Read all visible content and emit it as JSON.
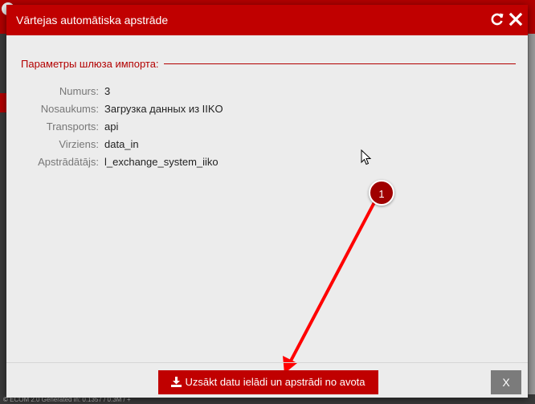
{
  "background": {
    "footer_text": "© ECOM 2.0 Generated in: 0.1357 / 0.3M / +"
  },
  "modal": {
    "title": "Vārtejas automātiska apstrāde",
    "header_icons": [
      "refresh-icon",
      "close-icon"
    ],
    "section_legend": "Параметры шлюза импорта:",
    "fields": [
      {
        "label": "Numurs:",
        "value": "3"
      },
      {
        "label": "Nosaukums:",
        "value": "Загрузка данных из IIKO"
      },
      {
        "label": "Transports:",
        "value": "api"
      },
      {
        "label": "Virziens:",
        "value": "data_in"
      },
      {
        "label": "Apstrādātājs:",
        "value": "l_exchange_system_iiko"
      }
    ],
    "annotation_marker": "1",
    "start_button_label": "Uzsākt datu ielādi un apstrādi no avota",
    "close_button_label": "X"
  },
  "colors": {
    "accent": "#c00000",
    "legend": "#b30000",
    "modal_bg": "#ececec",
    "close_btn": "#7b7b7b",
    "arrow": "#ff0000"
  }
}
